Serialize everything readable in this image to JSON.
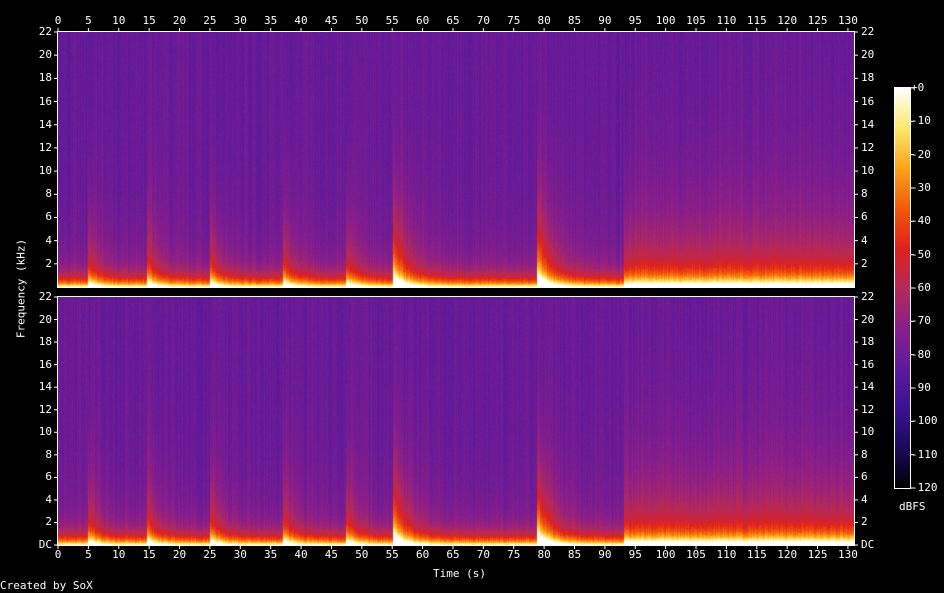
{
  "chart_data": {
    "type": "heatmap",
    "title": "",
    "xlabel": "Time (s)",
    "ylabel": "Frequency (kHz)",
    "xlim": [
      0,
      131
    ],
    "ylim": [
      0,
      22
    ],
    "x_ticks": [
      0,
      5,
      10,
      15,
      20,
      25,
      30,
      35,
      40,
      45,
      50,
      55,
      60,
      65,
      70,
      75,
      80,
      85,
      90,
      95,
      100,
      105,
      110,
      115,
      120,
      125,
      130
    ],
    "channels": [
      {
        "y_tick_labels": [
          "22",
          "20",
          "18",
          "16",
          "14",
          "12",
          "10",
          "8",
          "6",
          "4",
          "2"
        ],
        "y_tick_values": [
          22,
          20,
          18,
          16,
          14,
          12,
          10,
          8,
          6,
          4,
          2
        ]
      },
      {
        "y_tick_labels": [
          "22",
          "20",
          "18",
          "16",
          "14",
          "12",
          "10",
          "8",
          "6",
          "4",
          "2",
          "DC"
        ],
        "y_tick_values": [
          22,
          20,
          18,
          16,
          14,
          12,
          10,
          8,
          6,
          4,
          2,
          0
        ]
      }
    ],
    "onsets_s": [
      4.8,
      14.6,
      25.0,
      37.0,
      47.3,
      55.0,
      78.8
    ],
    "strong_onsets_s": [
      55.0,
      78.8
    ],
    "dense_region_s": [
      93,
      131
    ],
    "colorbar": {
      "label": "dBFS",
      "range": [
        -120,
        0
      ],
      "tick_labels": [
        "+0",
        "-10",
        "-20",
        "-30",
        "-40",
        "-50",
        "-60",
        "-70",
        "-80",
        "-90",
        "-100",
        "-110",
        "-120"
      ],
      "tick_values": [
        0,
        -10,
        -20,
        -30,
        -40,
        -50,
        -60,
        -70,
        -80,
        -90,
        -100,
        -110,
        -120
      ],
      "colormap": [
        "#000000",
        "#1a0a5a",
        "#3a1291",
        "#5e1a9a",
        "#8a1e8a",
        "#b42a5a",
        "#e0201c",
        "#f25a0a",
        "#fba31a",
        "#fde86a",
        "#ffffff"
      ]
    },
    "grid": false,
    "legend": "colorbar-right"
  },
  "credit": "Created by SoX"
}
